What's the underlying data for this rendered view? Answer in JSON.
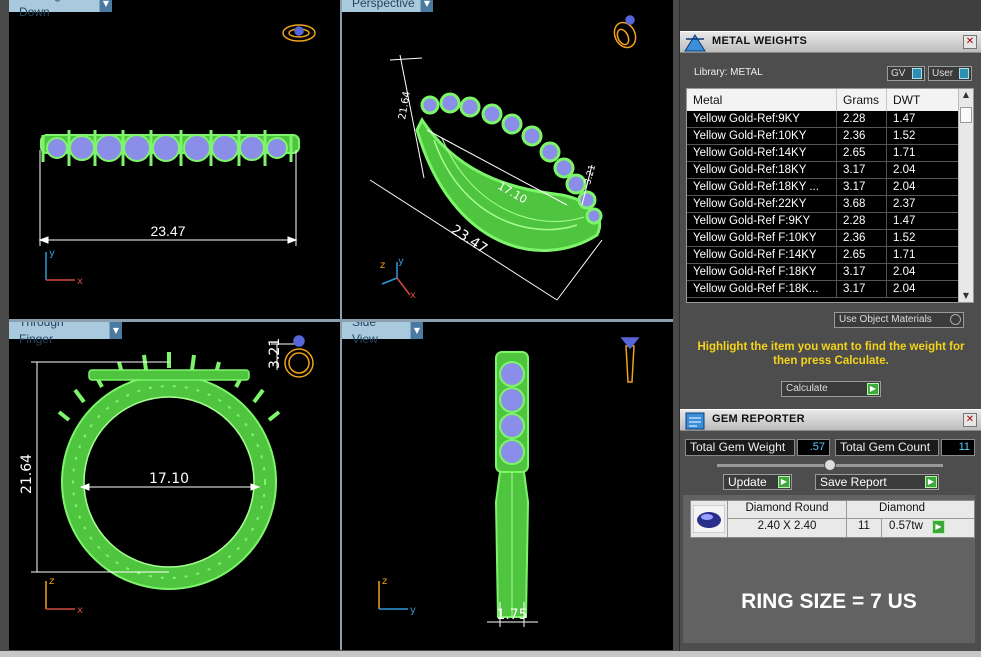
{
  "viewports": {
    "top_left": {
      "label": "Looking Down",
      "dimension": "23.47",
      "axis_up": "y",
      "axis_right": "x"
    },
    "top_right": {
      "label": "Perspective",
      "dim_height": "21.64",
      "dim_inner": "17.10",
      "dim_length": "23.47",
      "dim_small": "3.21",
      "axis_up": "y",
      "axis_left": "z",
      "axis_right": "x"
    },
    "bottom_left": {
      "label": "Through Finger",
      "dim_height": "21.64",
      "dim_inner": "17.10",
      "dim_small": "3.21",
      "axis_up": "z",
      "axis_right": "x"
    },
    "bottom_right": {
      "label": "Side View",
      "dim_width": "1.75",
      "axis_up": "z",
      "axis_right": "y"
    }
  },
  "metal_weights": {
    "title": "METAL WEIGHTS",
    "library_label": "Library: METAL",
    "toggle_gv": "GV",
    "toggle_user": "User",
    "columns": [
      "Metal",
      "Grams",
      "DWT"
    ],
    "rows": [
      [
        "Yellow Gold-Ref:9KY",
        "2.28",
        "1.47"
      ],
      [
        "Yellow Gold-Ref:10KY",
        "2.36",
        "1.52"
      ],
      [
        "Yellow Gold-Ref:14KY",
        "2.65",
        "1.71"
      ],
      [
        "Yellow Gold-Ref:18KY",
        "3.17",
        "2.04"
      ],
      [
        "Yellow Gold-Ref:18KY ...",
        "3.17",
        "2.04"
      ],
      [
        "Yellow Gold-Ref:22KY",
        "3.68",
        "2.37"
      ],
      [
        "Yellow Gold-Ref F:9KY",
        "2.28",
        "1.47"
      ],
      [
        "Yellow Gold-Ref F:10KY",
        "2.36",
        "1.52"
      ],
      [
        "Yellow Gold-Ref F:14KY",
        "2.65",
        "1.71"
      ],
      [
        "Yellow Gold-Ref F:18KY",
        "3.17",
        "2.04"
      ],
      [
        "Yellow Gold-Ref F:18K...",
        "3.17",
        "2.04"
      ]
    ],
    "use_object_materials": "Use Object Materials",
    "hint": "Highlight the item you want to find the weight for then press Calculate.",
    "calculate": "Calculate"
  },
  "gem_reporter": {
    "title": "GEM REPORTER",
    "total_weight_label": "Total Gem Weight",
    "total_weight_value": ".57",
    "total_count_label": "Total Gem Count",
    "total_count_value": "11",
    "update_label": "Update",
    "save_report_label": "Save Report",
    "gem": {
      "shape": "Diamond Round",
      "size": "2.40 X 2.40",
      "material": "Diamond",
      "count": "11",
      "tw": "0.57tw"
    }
  },
  "ring_size": "RING SIZE = 7 US",
  "colors": {
    "wire_green": "#7df56a",
    "stone_blue": "#8b8ee8",
    "dim_white": "#ffffff",
    "hint_yellow": "#f4d31c",
    "ring_gold": "#f0a21a"
  }
}
